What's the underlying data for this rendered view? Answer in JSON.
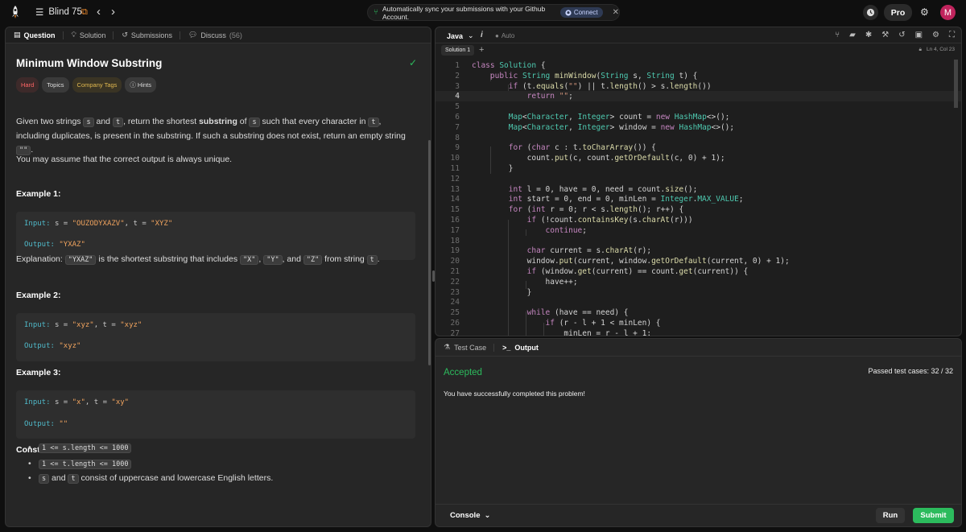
{
  "topbar": {
    "list_label": "Blind 75",
    "sync_text": "Automatically sync your submissions with your Github Account.",
    "connect_label": "Connect",
    "pro_label": "Pro",
    "avatar_letter": "M"
  },
  "left_tabs": [
    {
      "label": "Question",
      "icon": "doc-icon"
    },
    {
      "label": "Solution",
      "icon": "bulb-icon"
    },
    {
      "label": "Submissions",
      "icon": "history-icon"
    },
    {
      "label": "Discuss",
      "count": "(56)",
      "icon": "chat-icon"
    }
  ],
  "problem": {
    "title": "Minimum Window Substring",
    "tags": [
      "Hard",
      "Topics",
      "Company Tags",
      "Hints"
    ],
    "desc_1": "Given two strings ",
    "desc_s": "s",
    "desc_2": " and ",
    "desc_t": "t",
    "desc_3": ", return the shortest ",
    "desc_bold": "substring",
    "desc_4": " of ",
    "desc_s2": "s",
    "desc_5": " such that every character in ",
    "desc_t2": "t",
    "desc_6": ", including duplicates, is present in the substring. If such a substring does not exist, return an empty string ",
    "desc_empty": "\"\"",
    "desc_7": ".",
    "para2": "You may assume that the correct output is always unique.",
    "ex1_heading": "Example 1:",
    "ex1_input_label": "Input:",
    "ex1_input_a": "s = ",
    "ex1_input_s": "\"OUZODYXAZV\"",
    "ex1_input_b": ", t = ",
    "ex1_input_t": "\"XYZ\"",
    "ex1_output_label": "Output:",
    "ex1_output_val": "\"YXAZ\"",
    "expl_1": "Explanation: ",
    "expl_c1": "\"YXAZ\"",
    "expl_2": " is the shortest substring that includes ",
    "expl_c2": "\"X\"",
    "expl_3": ", ",
    "expl_c3": "\"Y\"",
    "expl_4": ", and ",
    "expl_c4": "\"Z\"",
    "expl_5": " from string ",
    "expl_c5": "t",
    "expl_6": ".",
    "ex2_heading": "Example 2:",
    "ex2_input_label": "Input:",
    "ex2_input_a": "s = ",
    "ex2_input_s": "\"xyz\"",
    "ex2_input_b": ", t = ",
    "ex2_input_t": "\"xyz\"",
    "ex2_output_label": "Output:",
    "ex2_output_val": "\"xyz\"",
    "ex3_heading": "Example 3:",
    "ex3_input_label": "Input:",
    "ex3_input_a": "s = ",
    "ex3_input_s": "\"x\"",
    "ex3_input_b": ", t = ",
    "ex3_input_t": "\"xy\"",
    "ex3_output_label": "Output:",
    "ex3_output_val": "\"\"",
    "constraints_heading": "Constraints:",
    "c1": "1 <= s.length <= 1000",
    "c2": "1 <= t.length <= 1000",
    "c3_s": "s",
    "c3_and": " and ",
    "c3_t": "t",
    "c3_rest": " consist of uppercase and lowercase English letters."
  },
  "editor": {
    "language": "Java",
    "auto": "Auto",
    "tab": "Solution 1",
    "cursor": "Ln 4, Col 23",
    "current_line": 4,
    "lines": [
      [
        [
          "kw",
          "class "
        ],
        [
          "ty",
          "Solution"
        ],
        [
          "pl",
          " {"
        ]
      ],
      [
        [
          "pl",
          "    "
        ],
        [
          "kw",
          "public "
        ],
        [
          "ty",
          "String "
        ],
        [
          "fn",
          "minWindow"
        ],
        [
          "pl",
          "("
        ],
        [
          "ty",
          "String "
        ],
        [
          "pl",
          "s, "
        ],
        [
          "ty",
          "String "
        ],
        [
          "pl",
          "t) {"
        ]
      ],
      [
        [
          "pl",
          "        "
        ],
        [
          "kw",
          "if "
        ],
        [
          "pl",
          "(t."
        ],
        [
          "fn",
          "equals"
        ],
        [
          "pl",
          "("
        ],
        [
          "st",
          "\"\""
        ],
        [
          "pl",
          ") || t."
        ],
        [
          "fn",
          "length"
        ],
        [
          "pl",
          "() > s."
        ],
        [
          "fn",
          "length"
        ],
        [
          "pl",
          "())"
        ]
      ],
      [
        [
          "pl",
          "            "
        ],
        [
          "kw",
          "return "
        ],
        [
          "st",
          "\"\""
        ],
        [
          "pl",
          ";"
        ]
      ],
      [],
      [
        [
          "pl",
          "        "
        ],
        [
          "ty",
          "Map"
        ],
        [
          "pl",
          "<"
        ],
        [
          "ty",
          "Character"
        ],
        [
          "pl",
          ", "
        ],
        [
          "ty",
          "Integer"
        ],
        [
          "pl",
          "> count = "
        ],
        [
          "kw",
          "new "
        ],
        [
          "ty",
          "HashMap"
        ],
        [
          "pl",
          "<>();"
        ]
      ],
      [
        [
          "pl",
          "        "
        ],
        [
          "ty",
          "Map"
        ],
        [
          "pl",
          "<"
        ],
        [
          "ty",
          "Character"
        ],
        [
          "pl",
          ", "
        ],
        [
          "ty",
          "Integer"
        ],
        [
          "pl",
          "> window = "
        ],
        [
          "kw",
          "new "
        ],
        [
          "ty",
          "HashMap"
        ],
        [
          "pl",
          "<>();"
        ]
      ],
      [],
      [
        [
          "pl",
          "        "
        ],
        [
          "kw",
          "for "
        ],
        [
          "pl",
          "("
        ],
        [
          "kw",
          "char "
        ],
        [
          "pl",
          "c : t."
        ],
        [
          "fn",
          "toCharArray"
        ],
        [
          "pl",
          "()) {"
        ]
      ],
      [
        [
          "pl",
          "            count."
        ],
        [
          "fn",
          "put"
        ],
        [
          "pl",
          "(c, count."
        ],
        [
          "fn",
          "getOrDefault"
        ],
        [
          "pl",
          "(c, 0) + 1);"
        ]
      ],
      [
        [
          "pl",
          "        }"
        ]
      ],
      [],
      [
        [
          "pl",
          "        "
        ],
        [
          "kw",
          "int "
        ],
        [
          "pl",
          "l = 0, have = 0, need = count."
        ],
        [
          "fn",
          "size"
        ],
        [
          "pl",
          "();"
        ]
      ],
      [
        [
          "pl",
          "        "
        ],
        [
          "kw",
          "int "
        ],
        [
          "pl",
          "start = 0, end = 0, minLen = "
        ],
        [
          "ty",
          "Integer"
        ],
        [
          "pl",
          "."
        ],
        [
          "ty",
          "MAX_VALUE"
        ],
        [
          "pl",
          ";"
        ]
      ],
      [
        [
          "pl",
          "        "
        ],
        [
          "kw",
          "for "
        ],
        [
          "pl",
          "("
        ],
        [
          "kw",
          "int "
        ],
        [
          "pl",
          "r = 0; r < s."
        ],
        [
          "fn",
          "length"
        ],
        [
          "pl",
          "(); r++) {"
        ]
      ],
      [
        [
          "pl",
          "            "
        ],
        [
          "kw",
          "if "
        ],
        [
          "pl",
          "(!count."
        ],
        [
          "fn",
          "containsKey"
        ],
        [
          "pl",
          "(s."
        ],
        [
          "fn",
          "charAt"
        ],
        [
          "pl",
          "(r)))"
        ]
      ],
      [
        [
          "pl",
          "                "
        ],
        [
          "kw",
          "continue"
        ],
        [
          "pl",
          ";"
        ]
      ],
      [],
      [
        [
          "pl",
          "            "
        ],
        [
          "kw",
          "char "
        ],
        [
          "pl",
          "current = s."
        ],
        [
          "fn",
          "charAt"
        ],
        [
          "pl",
          "(r);"
        ]
      ],
      [
        [
          "pl",
          "            window."
        ],
        [
          "fn",
          "put"
        ],
        [
          "pl",
          "(current, window."
        ],
        [
          "fn",
          "getOrDefault"
        ],
        [
          "pl",
          "(current, 0) + 1);"
        ]
      ],
      [
        [
          "pl",
          "            "
        ],
        [
          "kw",
          "if "
        ],
        [
          "pl",
          "(window."
        ],
        [
          "fn",
          "get"
        ],
        [
          "pl",
          "(current) == count."
        ],
        [
          "fn",
          "get"
        ],
        [
          "pl",
          "(current)) {"
        ]
      ],
      [
        [
          "pl",
          "                have++;"
        ]
      ],
      [
        [
          "pl",
          "            }"
        ]
      ],
      [],
      [
        [
          "pl",
          "            "
        ],
        [
          "kw",
          "while "
        ],
        [
          "pl",
          "(have == need) {"
        ]
      ],
      [
        [
          "pl",
          "                "
        ],
        [
          "kw",
          "if "
        ],
        [
          "pl",
          "(r - l + 1 < minLen) {"
        ]
      ],
      [
        [
          "pl",
          "                    minLen = r - l + 1;"
        ]
      ]
    ]
  },
  "output": {
    "tabs": [
      "Test Case",
      "Output"
    ],
    "status": "Accepted",
    "passed": "Passed test cases: 32 / 32",
    "message": "You have successfully completed this problem!",
    "console_label": "Console",
    "run_label": "Run",
    "submit_label": "Submit",
    "accent": "#2cbb5d"
  }
}
